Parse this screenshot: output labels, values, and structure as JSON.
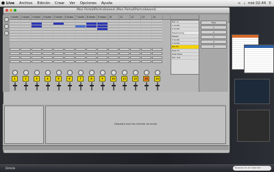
{
  "menubar": {
    "app": "Live",
    "items": [
      "Archivo",
      "Edición",
      "Crear",
      "Ver",
      "Opciones",
      "Ayuda"
    ],
    "clock": "mié 02:44"
  },
  "window": {
    "title": "Mon PortaitPortraitwand (Mon PortaitPortraitwand)"
  },
  "tracks": {
    "headers": [
      "1 Audio",
      "2 Audio",
      "3 Audio",
      "4 Audio",
      "5 Audio",
      "6 Audio",
      "7 Audio",
      "8 Audio",
      "9 Audio",
      "10 Audio",
      "11 Audio",
      "12 Audio",
      "13 Audio",
      "14 Audio"
    ],
    "numbers": [
      "1",
      "2",
      "3",
      "4",
      "5",
      "6",
      "7",
      "8",
      "9",
      "10",
      "11",
      "12",
      "13",
      "14"
    ]
  },
  "browser": {
    "rows": [
      "Ext. In",
      "1 Audio",
      "2 Audio",
      "Resampling",
      "Master",
      "3 Audio",
      "4 Audio",
      "Pre FX",
      "Post FX",
      "Post Mixer",
      "Ext. Out"
    ]
  },
  "master": {
    "buttons": [
      "Stop",
      "1",
      "2",
      "3",
      "4",
      "5"
    ]
  },
  "lower_panel": {
    "hint": "Deposite aquí los efectos de audio"
  },
  "dock": {
    "label": "Detalle",
    "search_placeholder": "Buscar en el Internet"
  },
  "colors": {
    "clip_blue": "#2b36b8",
    "track_number_yellow": "#f0d400",
    "track_number_orange": "#f07a20",
    "selected_row": "#f2d200"
  }
}
